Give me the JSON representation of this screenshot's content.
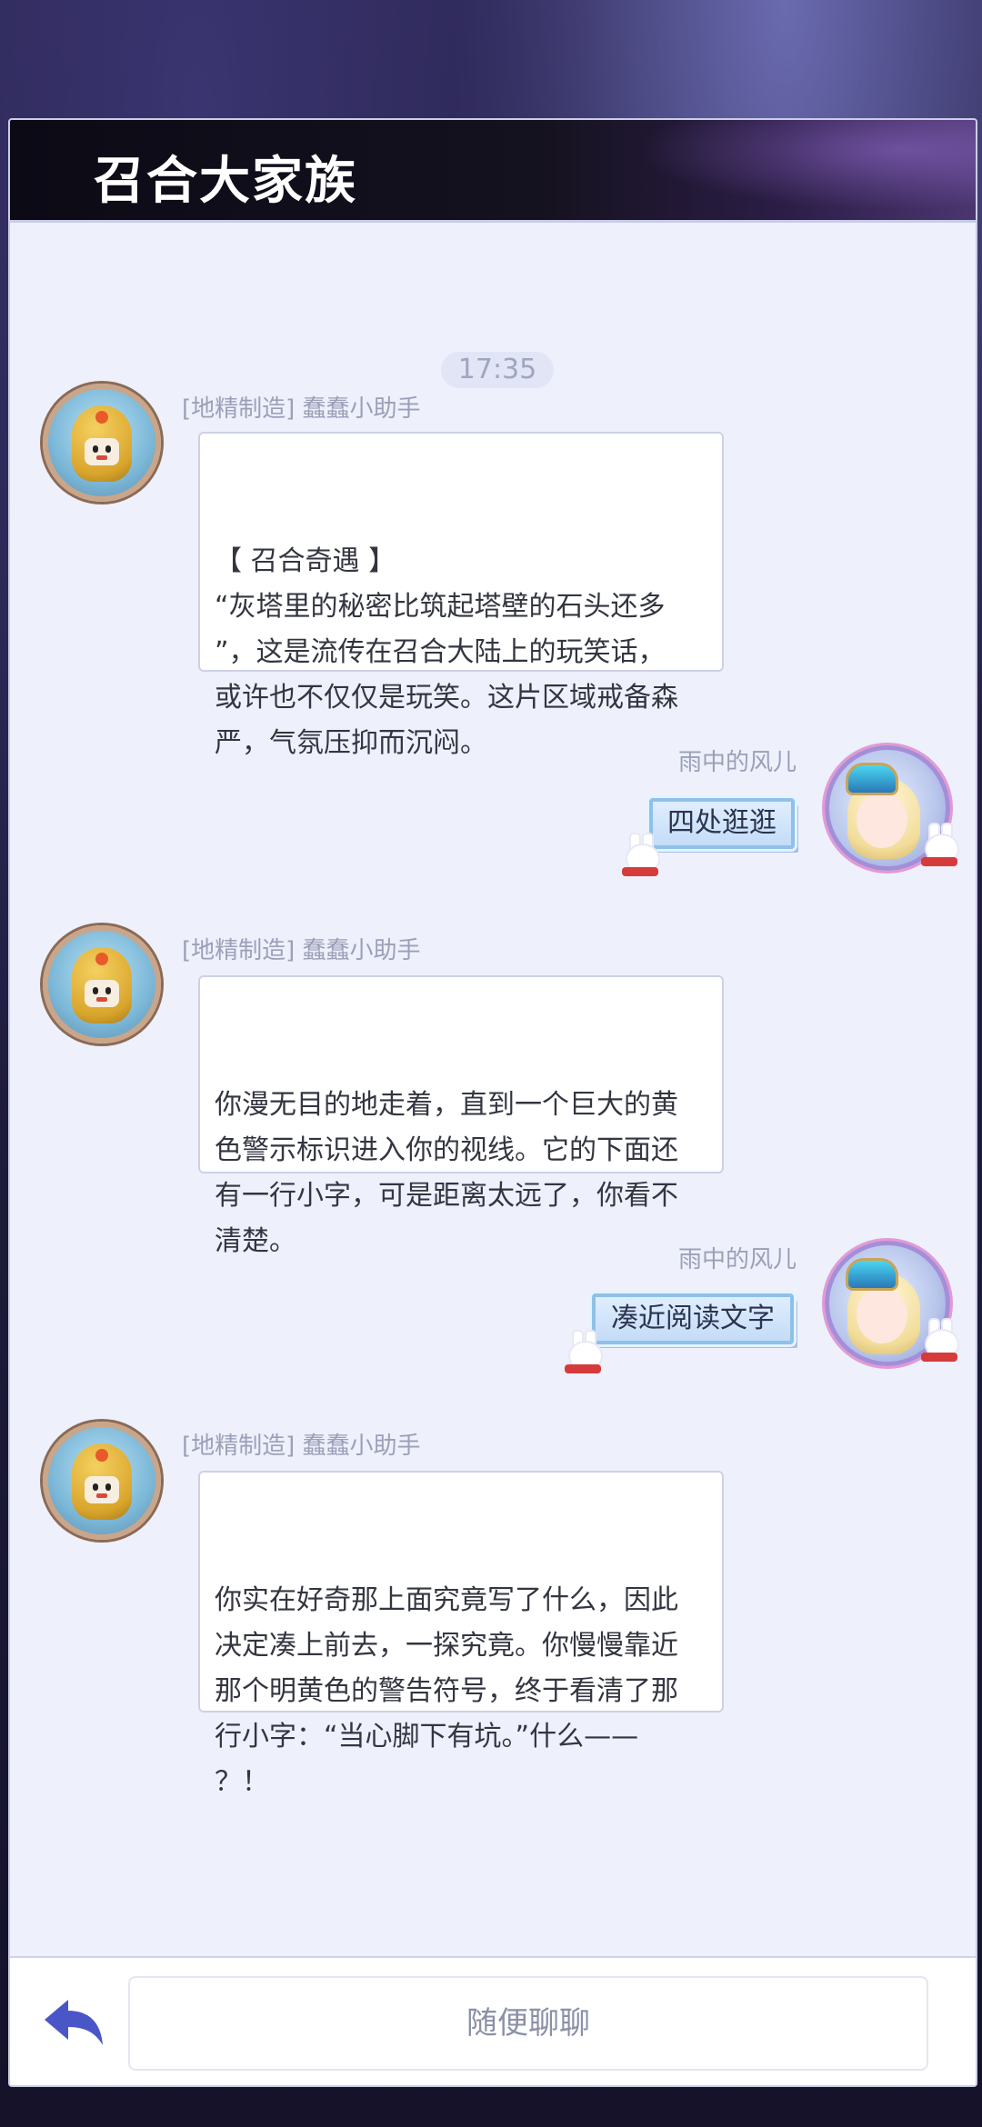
{
  "header": {
    "title": "召合大家族"
  },
  "chat": {
    "time": "17:35",
    "messages": [
      {
        "sender": "[地精制造] 蠢蠢小助手",
        "heading": "【 召合奇遇 】",
        "text": "“灰塔里的秘密比筑起塔壁的石头还多\n”，这是流传在召合大陆上的玩笑话，\n或许也不仅仅是玩笑。这片区域戒备森\n严，气氛压抑而沉闷。"
      },
      {
        "sender": "雨中的风儿",
        "text": "四处逛逛"
      },
      {
        "sender": "[地精制造] 蠢蠢小助手",
        "text": "你漫无目的地走着，直到一个巨大的黄\n色警示标识进入你的视线。它的下面还\n有一行小字，可是距离太远了，你看不\n清楚。"
      },
      {
        "sender": "雨中的风儿",
        "text": "凑近阅读文字"
      },
      {
        "sender": "[地精制造] 蠢蠢小助手",
        "text": "你实在好奇那上面究竟写了什么，因此\n决定凑上前去，一探究竟。你慢慢靠近\n那个明黄色的警告符号，终于看清了那\n行小字：“当心脚下有坑。”什么——\n？！"
      }
    ]
  },
  "footer": {
    "input_placeholder": "随便聊聊",
    "back_icon": "back-arrow-icon"
  },
  "colors": {
    "accent": "#4a56c8",
    "panel_bg": "#eef0fb",
    "header_bg": "#0b0a15"
  }
}
